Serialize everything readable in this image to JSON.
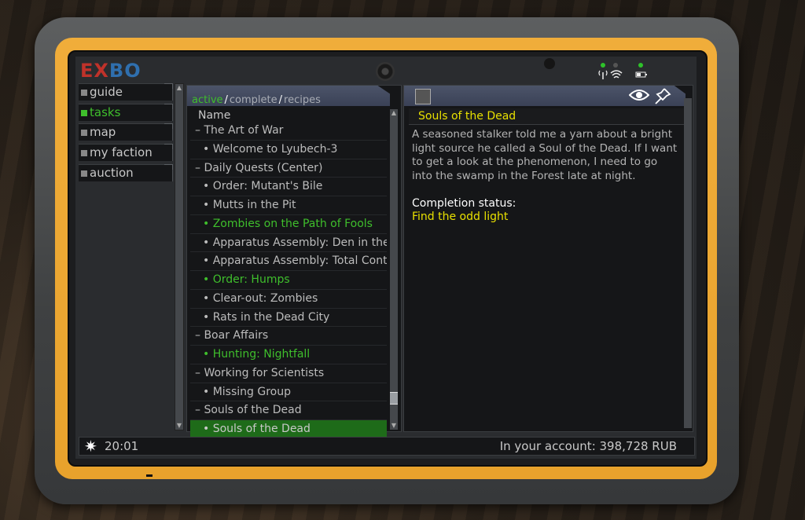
{
  "logo": {
    "part1": "EX",
    "part2": "BO"
  },
  "sidebar": {
    "items": [
      {
        "label": "guide",
        "active": false
      },
      {
        "label": "tasks",
        "active": true
      },
      {
        "label": "map",
        "active": false
      },
      {
        "label": "my faction",
        "active": false
      },
      {
        "label": "auction",
        "active": false
      }
    ]
  },
  "list": {
    "filters": {
      "active": "active",
      "complete": "complete",
      "recipes": "recipes",
      "separator": "/"
    },
    "column_name": "Name",
    "rows": [
      {
        "label": "– The Art of War",
        "type": "group",
        "state": "normal"
      },
      {
        "label": "• Welcome to Lyubech-3",
        "type": "child",
        "state": "normal"
      },
      {
        "label": "– Daily Quests (Center)",
        "type": "group",
        "state": "normal"
      },
      {
        "label": "• Order: Mutant's Bile",
        "type": "child",
        "state": "normal"
      },
      {
        "label": "• Mutts in the Pit",
        "type": "child",
        "state": "normal"
      },
      {
        "label": "• Zombies on the Path of Fools",
        "type": "child",
        "state": "green"
      },
      {
        "label": "• Apparatus Assembly: Den in the Pit",
        "type": "child",
        "state": "normal"
      },
      {
        "label": "• Apparatus Assembly: Total Control",
        "type": "child",
        "state": "normal"
      },
      {
        "label": "• Order: Humps",
        "type": "child",
        "state": "green"
      },
      {
        "label": "• Clear-out: Zombies",
        "type": "child",
        "state": "normal"
      },
      {
        "label": "• Rats in the Dead City",
        "type": "child",
        "state": "normal"
      },
      {
        "label": "– Boar Affairs",
        "type": "group",
        "state": "normal"
      },
      {
        "label": "• Hunting: Nightfall",
        "type": "child",
        "state": "green"
      },
      {
        "label": "– Working for Scientists",
        "type": "group",
        "state": "normal"
      },
      {
        "label": "• Missing Group",
        "type": "child",
        "state": "normal"
      },
      {
        "label": "– Souls of the Dead",
        "type": "group",
        "state": "normal"
      },
      {
        "label": "• Souls of the Dead",
        "type": "child",
        "state": "selected"
      }
    ]
  },
  "detail": {
    "title": "Souls of the Dead",
    "body": "A seasoned stalker told me a yarn about a bright light source he called a Soul of the Dead. If I want to get a look at the phenomenon, I need to go into the swamp in the Forest late at night.",
    "completion_label": "Completion status:",
    "completion_value": "Find the odd light"
  },
  "status": {
    "time": "20:01",
    "account": "In your account: 398,728 RUB"
  },
  "icons": {
    "status_left": "sun-icon",
    "detail_left": "map-icon",
    "detail_eye": "eye-icon",
    "detail_pin": "pin-icon"
  },
  "colors": {
    "active_green": "#3fbf2c",
    "highlight_yellow": "#e8e000",
    "selected_row": "#1e6b19",
    "device_orange": "#e8a22c"
  }
}
